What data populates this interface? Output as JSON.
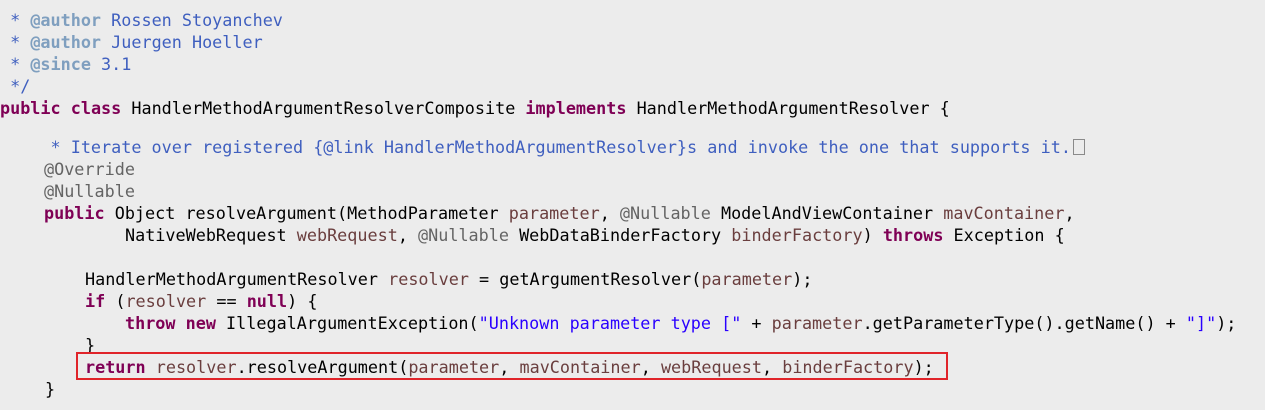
{
  "code": {
    "l1_star": " * ",
    "l1_tag": "@author",
    "l1_text": " Rossen Stoyanchev",
    "l2_star": " * ",
    "l2_tag": "@author",
    "l2_text": " Juergen Hoeller",
    "l3_star": " * ",
    "l3_tag": "@since",
    "l3_text": " 3.1",
    "l4": " */",
    "l5_kw1": "public",
    "l5_kw2": "class",
    "l5_name": "HandlerMethodArgumentResolverComposite",
    "l5_kw3": "implements",
    "l5_iface": "HandlerMethodArgumentResolver {",
    "l6_a": "     * Iterate over registered ",
    "l6_b": "{@link HandlerMethodArgumentResolver}",
    "l6_c": "s and invoke the one that supports it.",
    "l7": "@Override",
    "l8": "@Nullable",
    "l9_kw": "public",
    "l9_a": " Object resolveArgument(MethodParameter ",
    "l9_p1": "parameter",
    "l9_b": ", ",
    "l9_ann": "@Nullable",
    "l9_c": " ModelAndViewContainer ",
    "l9_p2": "mavContainer",
    "l9_d": ",",
    "l10_a": "NativeWebRequest ",
    "l10_p1": "webRequest",
    "l10_b": ", ",
    "l10_ann": "@Nullable",
    "l10_c": " WebDataBinderFactory ",
    "l10_p2": "binderFactory",
    "l10_d": ") ",
    "l10_kw": "throws",
    "l10_e": " Exception {",
    "l11_a": "HandlerMethodArgumentResolver ",
    "l11_v": "resolver",
    "l11_b": " = getArgumentResolver(",
    "l11_p": "parameter",
    "l11_c": ");",
    "l12_kw": "if",
    "l12_a": " (",
    "l12_v": "resolver",
    "l12_b": " == ",
    "l12_null": "null",
    "l12_c": ") {",
    "l13_kw1": "throw",
    "l13_kw2": "new",
    "l13_a": " IllegalArgumentException(",
    "l13_s1": "\"Unknown parameter type [\"",
    "l13_b": " + ",
    "l13_p": "parameter",
    "l13_c": ".getParameterType().getName() + ",
    "l13_s2": "\"]\"",
    "l13_d": ");",
    "l14": "}",
    "l15_kw": "return",
    "l15_v": "resolver",
    "l15_a": ".resolveArgument(",
    "l15_p1": "parameter",
    "l15_b": ", ",
    "l15_p2": "mavContainer",
    "l15_c": ", ",
    "l15_p3": "webRequest",
    "l15_d": ", ",
    "l15_p4": "binderFactory",
    "l15_e": ");",
    "l16": "}"
  },
  "colors": {
    "keyword": "#7f0055",
    "javadoc": "#3f5fbf",
    "javadoc_tag": "#7f9fbf",
    "annotation": "#646464",
    "local_var": "#6a3e3e",
    "string": "#2a00ff",
    "highlight_box": "#e0242a"
  }
}
